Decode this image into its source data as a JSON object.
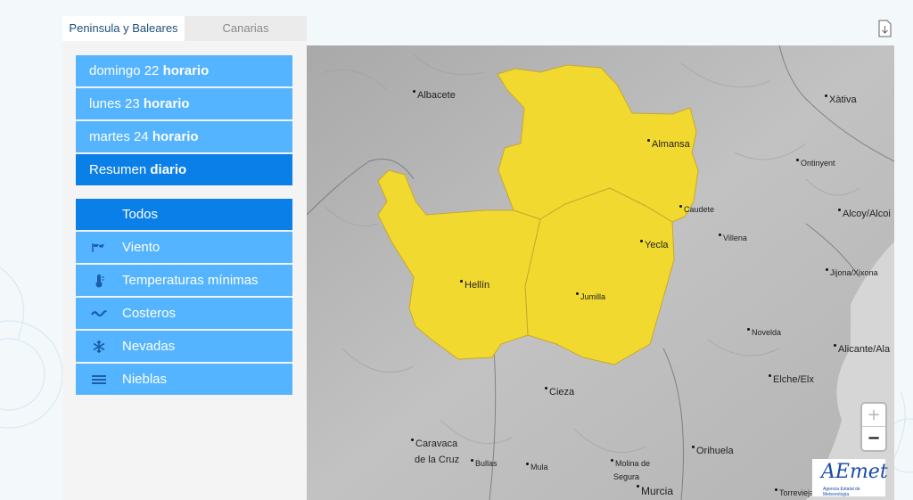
{
  "tabs": [
    {
      "label": "Peninsula y Baleares",
      "active": true
    },
    {
      "label": "Canarias",
      "active": false
    }
  ],
  "days": [
    {
      "day": "domingo 22",
      "kind": "horario"
    },
    {
      "day": "lunes 23",
      "kind": "horario"
    },
    {
      "day": "martes 24",
      "kind": "horario"
    },
    {
      "day": "Resumen",
      "kind": "diario",
      "selected": true
    }
  ],
  "phenomena": [
    {
      "label": "Todos",
      "icon": "",
      "selected": true
    },
    {
      "label": "Viento",
      "icon": "wind-icon"
    },
    {
      "label": "Temperaturas mínimas",
      "icon": "thermometer-icon"
    },
    {
      "label": "Costeros",
      "icon": "waves-icon"
    },
    {
      "label": "Nevadas",
      "icon": "snowflake-icon"
    },
    {
      "label": "Nieblas",
      "icon": "fog-icon"
    }
  ],
  "map": {
    "warning_color": "#f2d930",
    "cities": [
      {
        "name": "Albacete"
      },
      {
        "name": "Xàtiva"
      },
      {
        "name": "Almansa"
      },
      {
        "name": "Ontinyent"
      },
      {
        "name": "Caudete"
      },
      {
        "name": "Alcoy/Alcoi"
      },
      {
        "name": "Villena"
      },
      {
        "name": "Yecla"
      },
      {
        "name": "Jijona/Xixona"
      },
      {
        "name": "Hellín"
      },
      {
        "name": "Jumilla"
      },
      {
        "name": "Novelda"
      },
      {
        "name": "Alicante/Ala"
      },
      {
        "name": "Elche/Elx"
      },
      {
        "name": "Cieza"
      },
      {
        "name": "Caravaca"
      },
      {
        "name": "de la Cruz"
      },
      {
        "name": "Bullas"
      },
      {
        "name": "Mula"
      },
      {
        "name": "Molina de"
      },
      {
        "name": "Segura"
      },
      {
        "name": "Orihuela"
      },
      {
        "name": "Murcia"
      },
      {
        "name": "Torrevieja"
      }
    ],
    "zoom_in": "+",
    "zoom_out": "−"
  },
  "logo": {
    "text": "AEmet",
    "subtitle": "Agencia Estatal de Meteorología"
  }
}
